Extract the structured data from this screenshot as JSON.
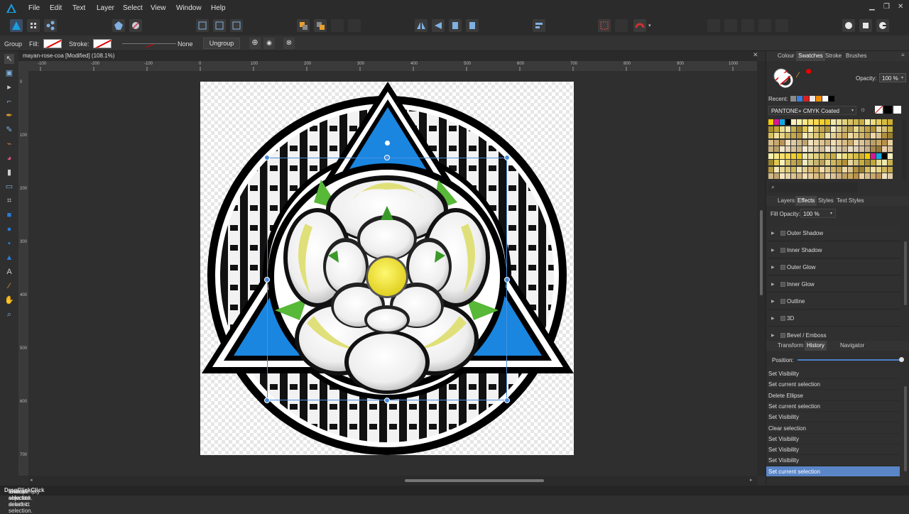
{
  "menu": {
    "items": [
      "File",
      "Edit",
      "Text",
      "Layer",
      "Select",
      "View",
      "Window",
      "Help"
    ]
  },
  "context": {
    "type_label": "Group",
    "fill_label": "Fill:",
    "stroke_label": "Stroke:",
    "stroke_width": "None",
    "ungroup_label": "Ungroup"
  },
  "document": {
    "tab_title": "mayan-rose-coa [Modified] (108.1%)"
  },
  "ruler": {
    "h_labels": [
      "-100",
      "-200",
      "-100",
      "0",
      "100",
      "200",
      "300",
      "400",
      "500",
      "600",
      "700",
      "800",
      "900",
      "1000"
    ],
    "v_labels": [
      "0",
      "100",
      "200",
      "300",
      "400",
      "500",
      "600",
      "700"
    ]
  },
  "colour_panel": {
    "tabs": [
      "Colour",
      "Swatches",
      "Stroke",
      "Brushes"
    ],
    "active_tab": "Swatches",
    "opacity_label": "Opacity:",
    "opacity_value": "100 %",
    "recent_label": "Recent:",
    "palette_name": "PANTONE+ CMYK Coated",
    "recent_colors": [
      "#8a8a8a",
      "#3b7ddd",
      "#d82020",
      "#e8e8e8",
      "#f08a00",
      "#ffffff",
      "#000000"
    ]
  },
  "effects_panel": {
    "tabs": [
      "Layers",
      "Effects",
      "Styles",
      "Text Styles"
    ],
    "active_tab": "Effects",
    "fill_opacity_label": "Fill Opacity:",
    "fill_opacity_value": "100 %",
    "effects": [
      "Outer Shadow",
      "Inner Shadow",
      "Outer Glow",
      "Inner Glow",
      "Outline",
      "3D",
      "Bevel / Emboss"
    ]
  },
  "history_panel": {
    "tabs": [
      "Transform",
      "History",
      "Navigator"
    ],
    "active_tab": "History",
    "position_label": "Position:",
    "entries": [
      "Set Visibility",
      "Set current selection",
      "Delete Ellipse",
      "Set current selection",
      "Set Visibility",
      "Clear selection",
      "Set Visibility",
      "Set Visibility",
      "Set Visibility",
      "Set current selection"
    ],
    "selected_index": 9
  },
  "status": {
    "p1": "'Group' selected. ",
    "b1": "Drag",
    "p2": " to move selection. ",
    "b2": "Click",
    "p3": " another object to select it. ",
    "b3": "Click",
    "p4": " on an empty area to deselect selection."
  },
  "colors": {
    "accent": "#5a86c8",
    "triangle_blue": "#1a86e0",
    "rose_yellow": "#f0e040",
    "leaf_green": "#58b838"
  }
}
